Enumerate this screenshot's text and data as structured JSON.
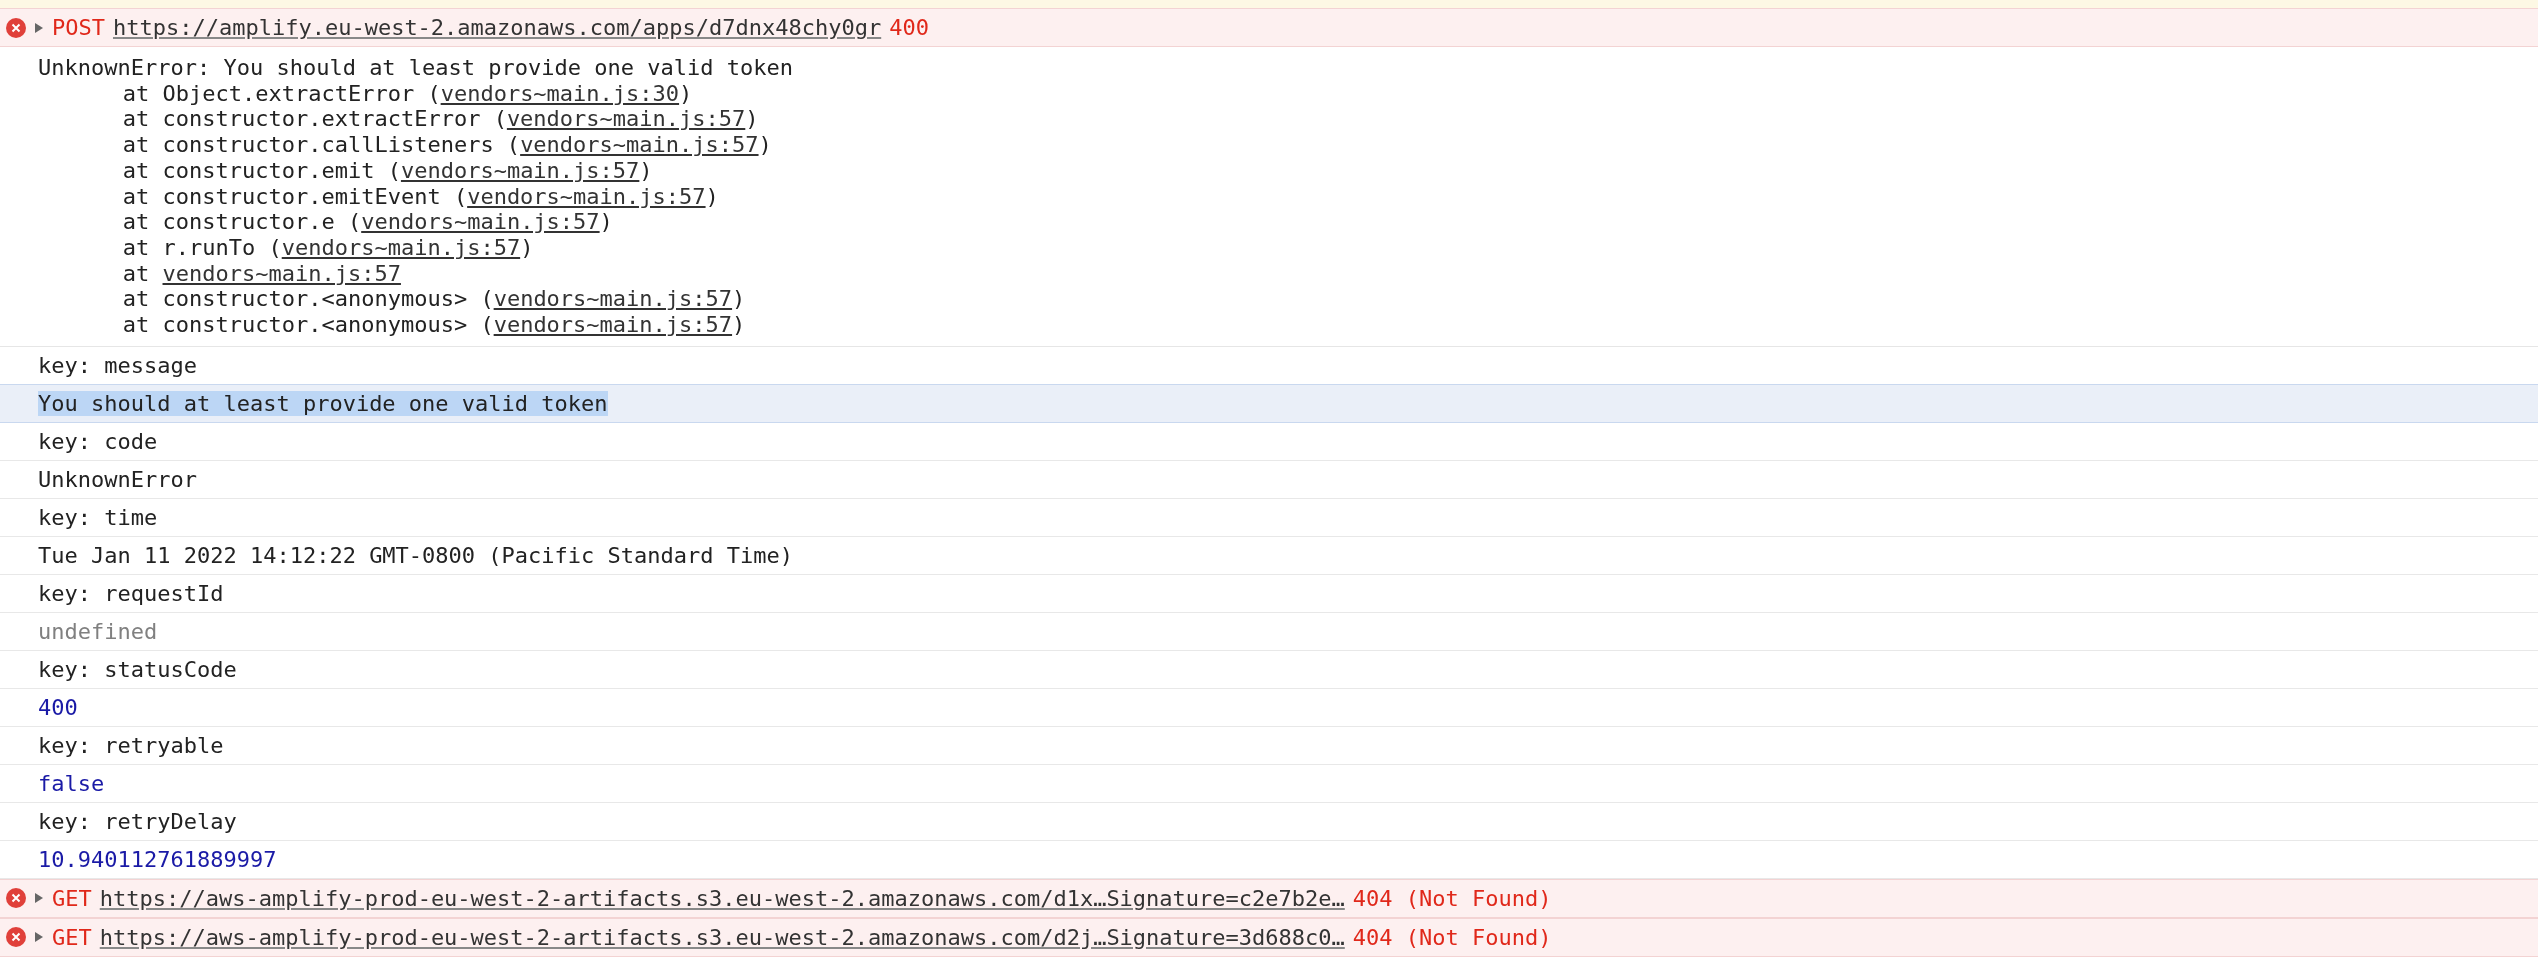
{
  "top_request": {
    "method": "POST",
    "url": "https://amplify.eu-west-2.amazonaws.com/apps/d7dnx48chy0gr",
    "status": "400",
    "expanded": false
  },
  "stack": {
    "message": "UnknownError: You should at least provide one valid token",
    "frames": [
      {
        "prefix": "at Object.extractError (",
        "link": "vendors~main.js:30",
        "suffix": ")"
      },
      {
        "prefix": "at constructor.extractError (",
        "link": "vendors~main.js:57",
        "suffix": ")"
      },
      {
        "prefix": "at constructor.callListeners (",
        "link": "vendors~main.js:57",
        "suffix": ")"
      },
      {
        "prefix": "at constructor.emit (",
        "link": "vendors~main.js:57",
        "suffix": ")"
      },
      {
        "prefix": "at constructor.emitEvent (",
        "link": "vendors~main.js:57",
        "suffix": ")"
      },
      {
        "prefix": "at constructor.e (",
        "link": "vendors~main.js:57",
        "suffix": ")"
      },
      {
        "prefix": "at r.runTo (",
        "link": "vendors~main.js:57",
        "suffix": ")"
      },
      {
        "prefix": "at ",
        "link": "vendors~main.js:57"
      },
      {
        "prefix": "at constructor.<anonymous> (",
        "link": "vendors~main.js:57",
        "suffix": ")"
      },
      {
        "prefix": "at constructor.<anonymous> (",
        "link": "vendors~main.js:57",
        "suffix": ")"
      }
    ]
  },
  "entries": [
    {
      "text": "key: message",
      "kind": "key",
      "selected": false
    },
    {
      "text": "You should at least provide one valid token",
      "kind": "string",
      "selected": true
    },
    {
      "text": "key: code",
      "kind": "key",
      "selected": false
    },
    {
      "text": "UnknownError",
      "kind": "string",
      "selected": false
    },
    {
      "text": "key: time",
      "kind": "key",
      "selected": false
    },
    {
      "text": "Tue Jan 11 2022 14:12:22 GMT-0800 (Pacific Standard Time)",
      "kind": "string",
      "selected": false
    },
    {
      "text": "key: requestId",
      "kind": "key",
      "selected": false
    },
    {
      "text": "undefined",
      "kind": "undefined",
      "selected": false
    },
    {
      "text": "key: statusCode",
      "kind": "key",
      "selected": false
    },
    {
      "text": "400",
      "kind": "number",
      "selected": false
    },
    {
      "text": "key: retryable",
      "kind": "key",
      "selected": false
    },
    {
      "text": "false",
      "kind": "boolean",
      "selected": false
    },
    {
      "text": "key: retryDelay",
      "kind": "key",
      "selected": false
    },
    {
      "text": "10.940112761889997",
      "kind": "number",
      "selected": false
    }
  ],
  "bottom_requests": [
    {
      "method": "GET",
      "url": "https://aws-amplify-prod-eu-west-2-artifacts.s3.eu-west-2.amazonaws.com/d1x…Signature=c2e7b2e…",
      "status": "404 (Not Found)",
      "expanded": false
    },
    {
      "method": "GET",
      "url": "https://aws-amplify-prod-eu-west-2-artifacts.s3.eu-west-2.amazonaws.com/d2j…Signature=3d688c0…",
      "status": "404 (Not Found)",
      "expanded": false
    }
  ]
}
